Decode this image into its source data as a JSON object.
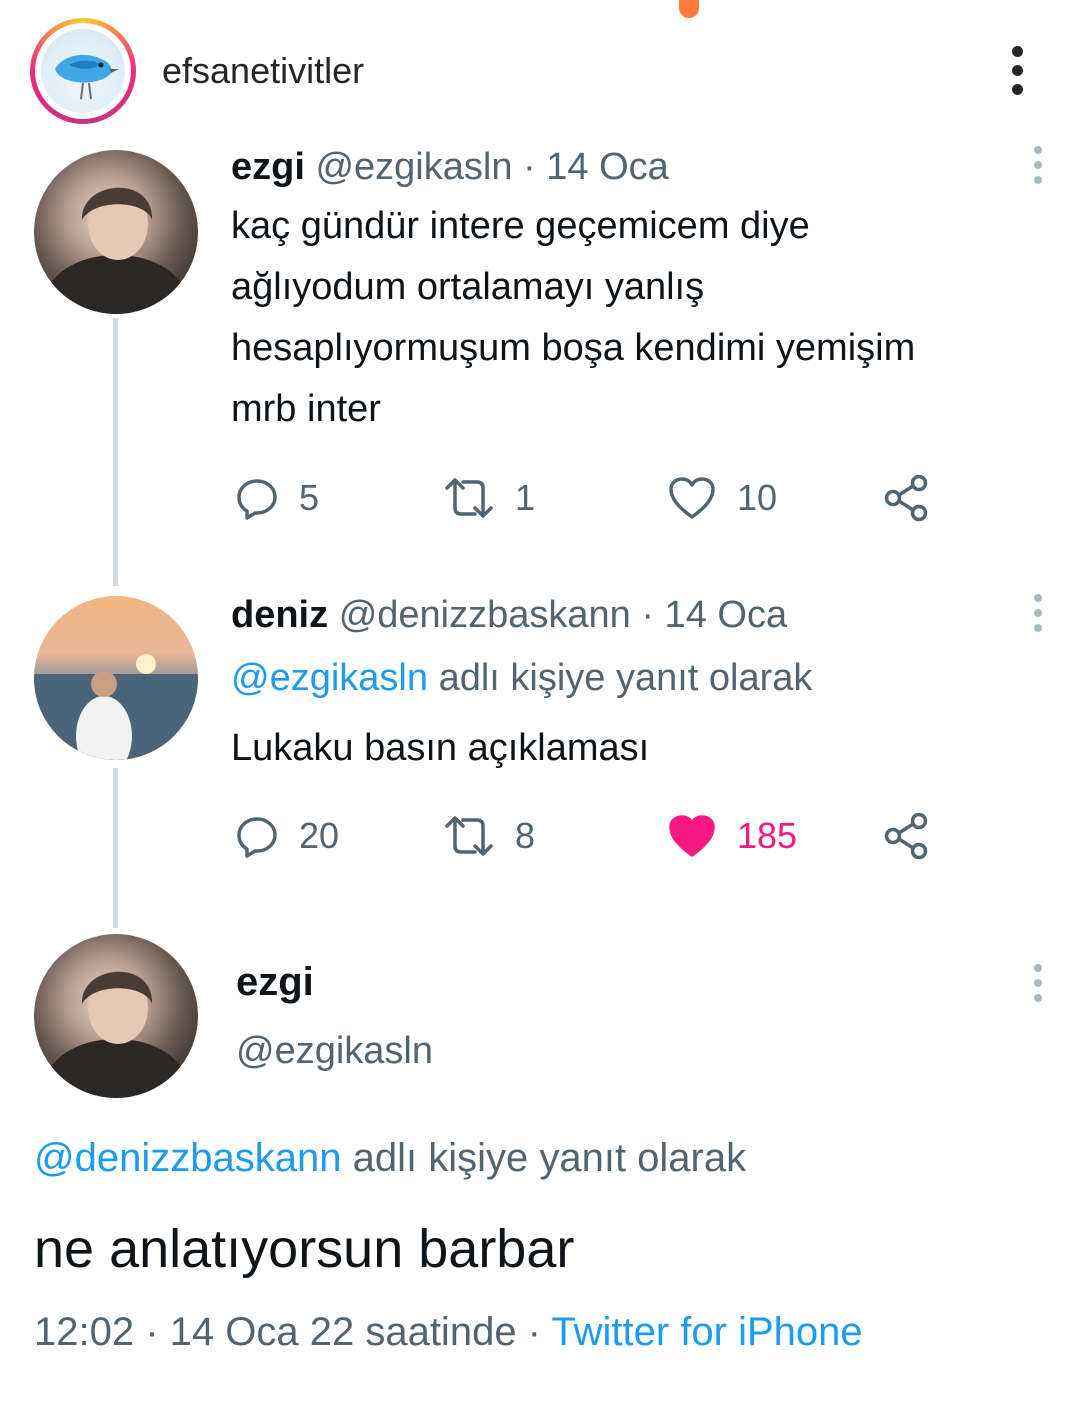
{
  "header": {
    "username": "efsanetivitler"
  },
  "tweets": [
    {
      "name": "ezgi",
      "handle": "@ezgikasln",
      "date": "· 14 Oca",
      "lines": [
        "kaç gündür intere geçemicem diye",
        "ağlıyodum ortalamayı yanlış",
        "hesaplıyormuşum boşa kendimi yemişim",
        "mrb inter"
      ],
      "replies": "5",
      "retweets": "1",
      "likes": "10"
    },
    {
      "name": "deniz",
      "handle": "@denizzbaskann",
      "date": "· 14 Oca",
      "reply_mention": "@ezgikasln",
      "reply_suffix": "adlı kişiye yanıt olarak",
      "text": "Lukaku basın açıklaması",
      "replies": "20",
      "retweets": "8",
      "likes": "185",
      "liked_color": "#f91880"
    }
  ],
  "detail": {
    "name": "ezgi",
    "handle": "@ezgikasln",
    "reply_mention": "@denizzbaskann",
    "reply_suffix": "adlı kişiye yanıt olarak",
    "text": "ne anlatıyorsun barbar",
    "timestamp": "12:02 · 14 Oca 22 saatinde ·",
    "source": "Twitter for iPhone"
  },
  "colors": {
    "link": "#1d9bf0",
    "muted": "#536471",
    "like": "#f91880",
    "thread_line": "#cfd9de"
  },
  "icons": [
    "more-vertical-icon",
    "reply-icon",
    "retweet-icon",
    "heart-icon",
    "share-icon"
  ]
}
